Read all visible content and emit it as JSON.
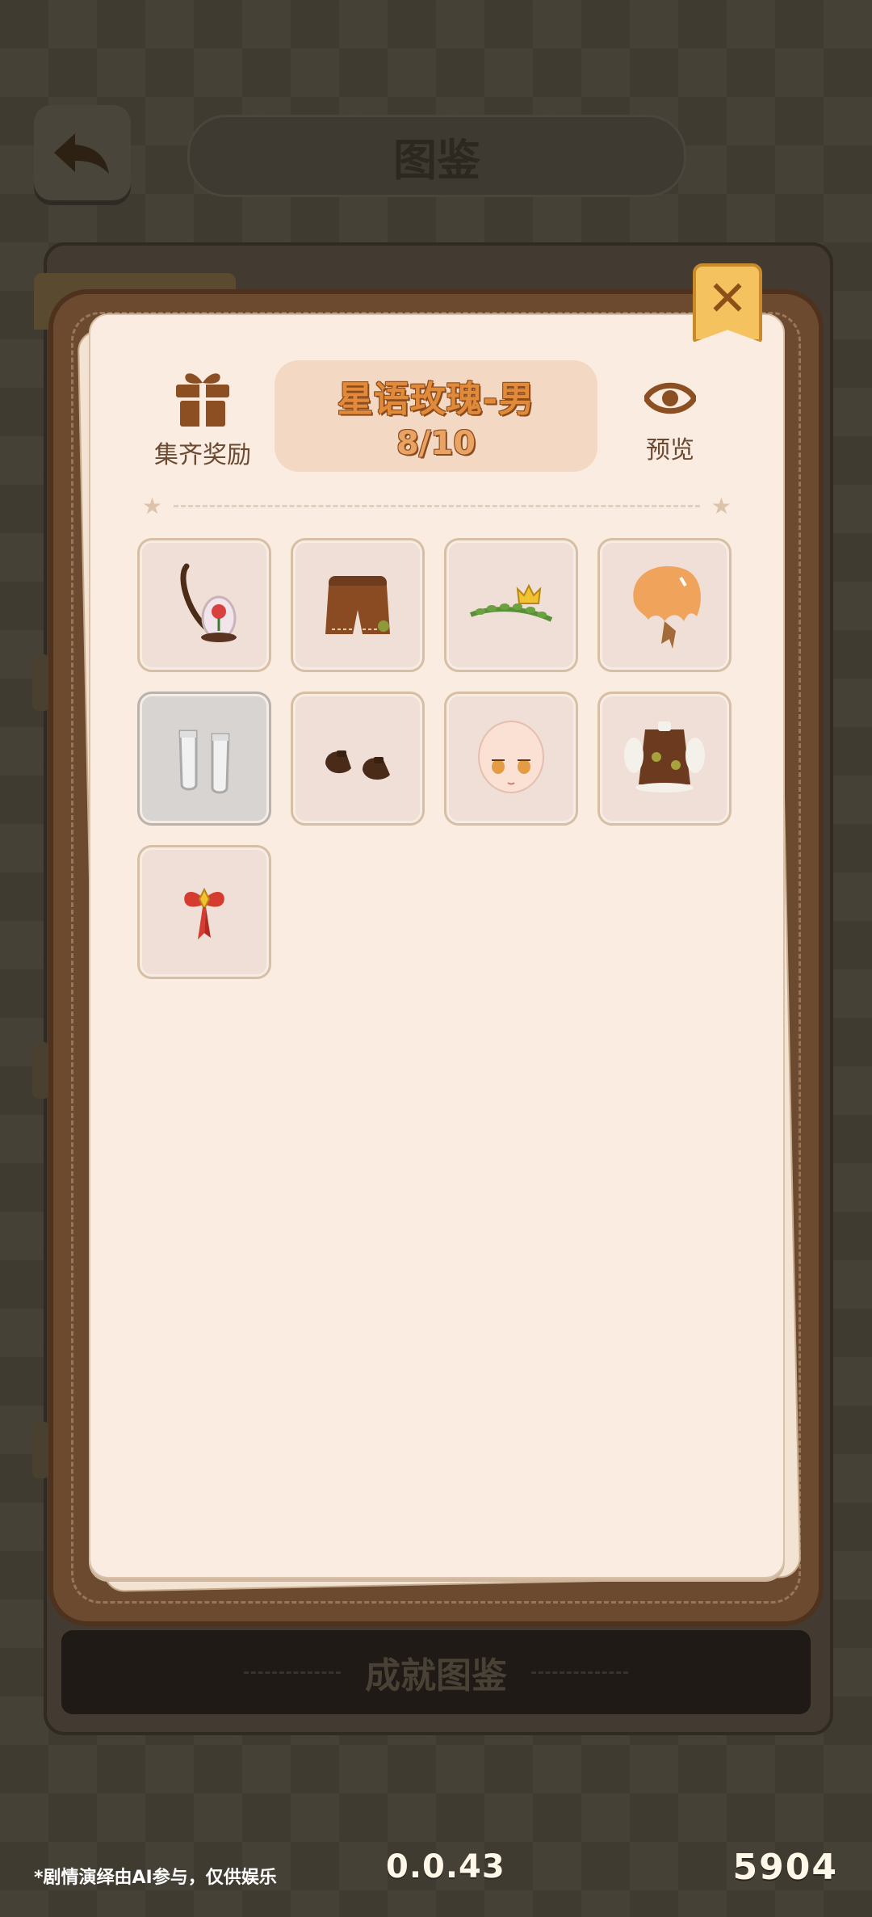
{
  "header": {
    "title": "图鉴"
  },
  "background_panel": {
    "label": "成就图鉴"
  },
  "modal": {
    "reward_label": "集齐奖励",
    "set_name": "星语玫瑰-男",
    "progress": "8/10",
    "preview_label": "预览"
  },
  "items": [
    {
      "icon": "rose-bag-icon",
      "locked": false
    },
    {
      "icon": "shorts-icon",
      "locked": false
    },
    {
      "icon": "crown-vine-icon",
      "locked": false
    },
    {
      "icon": "hair-icon",
      "locked": false
    },
    {
      "icon": "socks-icon",
      "locked": true
    },
    {
      "icon": "shoes-icon",
      "locked": false
    },
    {
      "icon": "face-icon",
      "locked": false
    },
    {
      "icon": "outfit-top-icon",
      "locked": false
    },
    {
      "icon": "bow-accessory-icon",
      "locked": false
    }
  ],
  "footer": {
    "note": "*剧情演绎由AI参与，仅供娱乐",
    "version": "0.0.43",
    "uid": "5904"
  },
  "colors": {
    "title_text": "#e08a3a",
    "title_outline": "#8a4a1d",
    "paper": "#fbece1",
    "frame": "#6b4a2f",
    "close_button": "#f5c260"
  }
}
